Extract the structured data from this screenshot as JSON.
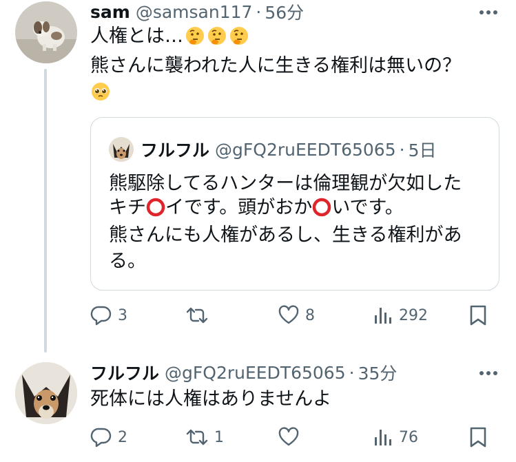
{
  "tweet1": {
    "author_name": "sam",
    "handle": "@samsan117",
    "separator": "·",
    "time": "56分",
    "text_line1": "人権とは…",
    "text_line1_emojis": [
      "thinking-face-emoji",
      "thinking-face-emoji",
      "thinking-face-emoji"
    ],
    "text_line2": "熊さんに襲われた人に生きる権利は無いの？",
    "text_line3_emoji": "pleading-face-emoji",
    "quote": {
      "author_name": "フルフル",
      "handle": "@gFQ2ruEEDT65065",
      "separator": "·",
      "time": "5日",
      "line1": "熊駆除してるハンターは倫理観が欠如した",
      "line2_a": "キチ",
      "line2_b": "イです。頭がおか",
      "line2_c": "いです。",
      "line3": "熊さんにも人権があるし、生きる権利があ",
      "line4": "る。"
    },
    "stats": {
      "replies": "3",
      "retweets": "",
      "likes": "8",
      "views": "292"
    }
  },
  "tweet2": {
    "author_name": "フルフル",
    "handle": "@gFQ2ruEEDT65065",
    "separator": "·",
    "time": "35分",
    "text": "死体には人権はありませんよ",
    "stats": {
      "replies": "2",
      "retweets": "1",
      "likes": "",
      "views": "76"
    }
  },
  "colors": {
    "text_primary": "#0f1419",
    "text_secondary": "#536471",
    "border": "#cfd9de",
    "circle_mark": "#e0242b"
  },
  "icons": {
    "more": "more-horizontal-icon",
    "reply": "reply-icon",
    "retweet": "retweet-icon",
    "like": "heart-icon",
    "views": "views-chart-icon",
    "bookmark": "bookmark-icon"
  }
}
